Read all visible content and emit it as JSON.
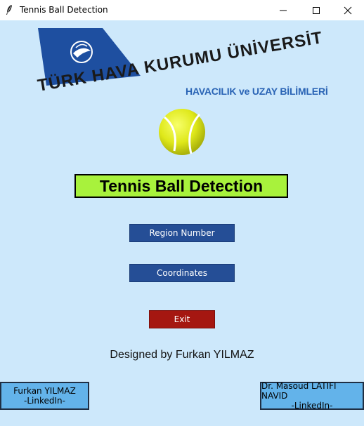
{
  "window": {
    "title": "Tennis Ball Detection",
    "icon": "feather-icon",
    "controls": [
      "minimize-icon",
      "maximize-icon",
      "close-icon"
    ]
  },
  "logo": {
    "university_name": "TÜRK HAVA KURUMU ÜNİVERSİTESİ",
    "faculty": "HAVACILIK ve UZAY BİLİMLERİ"
  },
  "heading": "Tennis Ball Detection",
  "buttons": {
    "region_number": "Region Number",
    "coordinates": "Coordinates",
    "exit": "Exit"
  },
  "designer": "Designed by Furkan YILMAZ",
  "links": {
    "left": {
      "name": "Furkan YILMAZ",
      "label": "-LinkedIn-"
    },
    "right": {
      "name": "Dr. Masoud LATIFI NAVID",
      "label": "-LinkedIn-"
    }
  },
  "colors": {
    "background": "#cde8fb",
    "heading_bg": "#a8f23c",
    "button_blue": "#254e96",
    "exit_red": "#a51711",
    "link_button": "#63b3ea",
    "logo_blue": "#1e4fa0",
    "faculty_text": "#2a64b5"
  }
}
